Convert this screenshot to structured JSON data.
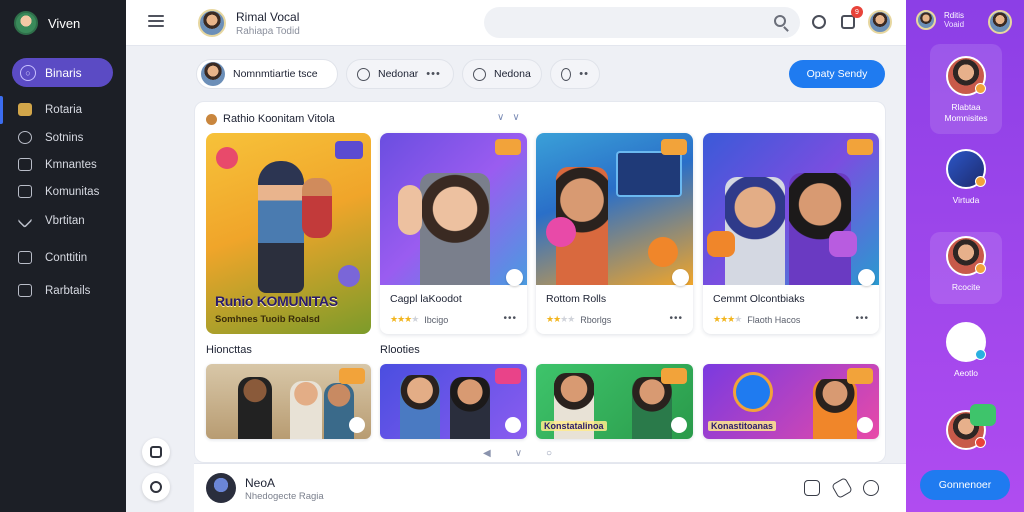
{
  "sidebar": {
    "brand": "Viven",
    "active_item": "Binaris",
    "items": [
      "Rotaria",
      "Sotnins",
      "Kmnantes",
      "Komunitas",
      "Vbrtitan",
      "Conttitin",
      "Rarbtails"
    ]
  },
  "topbar": {
    "user_name": "Rimal Vocal",
    "user_sub": "Rahiapa Todid",
    "search_placeholder": "",
    "notif_count": "9"
  },
  "chips": {
    "first": "Nomnmtiartie tsce",
    "second": "Nedonar",
    "third": "Nedona"
  },
  "create_button": "Opaty Sendy",
  "panel": {
    "title": "Rathio Koonitam Vitola",
    "feature": {
      "title": "Runio KOMUNITAS",
      "subtitle": "Somhnes Tuoib Roalsd"
    },
    "cards": [
      {
        "title": "Cagpl laKoodot",
        "meta": "Ibcigo"
      },
      {
        "title": "Rottom Rolls",
        "meta": "Rborlgs"
      },
      {
        "title": "Cemmt Olcontbiaks",
        "meta": "Flaoth Hacos"
      }
    ],
    "section_left": "Hioncttas",
    "section_right": "Rlooties",
    "mini_overlay_1": "Konstatalinoa",
    "mini_overlay_2": "Konastitoanas"
  },
  "bottombar": {
    "name": "NeoA",
    "sub": "Nhedogecte Ragia"
  },
  "rightpanel": {
    "head_line1": "Rditis",
    "head_line2": "Voaid",
    "items": [
      {
        "label": "Rlabtaa Momnisites"
      },
      {
        "label": "Virtuda"
      },
      {
        "label": "Rcocite"
      },
      {
        "label": "Aeotlo"
      }
    ],
    "button": "Gonnenoer"
  },
  "colors": {
    "sidebar_bg": "#1c1f26",
    "active_pill": "#5b4bc4",
    "primary_button": "#1f7bf0",
    "right_panel": "#9a45ea"
  }
}
